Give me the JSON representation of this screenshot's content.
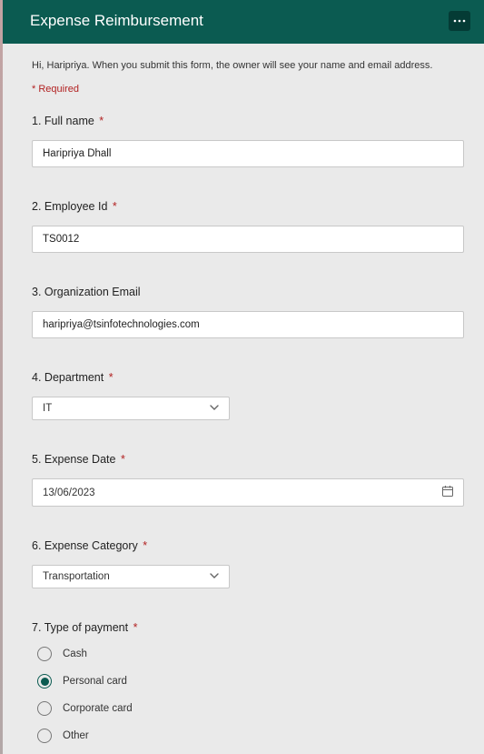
{
  "header": {
    "title": "Expense Reimbursement"
  },
  "intro": "Hi, Haripriya. When you submit this form, the owner will see your name and email address.",
  "required_note": "Required",
  "questions": {
    "q1": {
      "num": "1.",
      "label": "Full name",
      "required": true,
      "value": "Haripriya Dhall"
    },
    "q2": {
      "num": "2.",
      "label": "Employee Id",
      "required": true,
      "value": "TS0012"
    },
    "q3": {
      "num": "3.",
      "label": "Organization Email",
      "required": false,
      "value": "haripriya@tsinfotechnologies.com"
    },
    "q4": {
      "num": "4.",
      "label": "Department",
      "required": true,
      "value": "IT"
    },
    "q5": {
      "num": "5.",
      "label": "Expense Date",
      "required": true,
      "value": "13/06/2023"
    },
    "q6": {
      "num": "6.",
      "label": "Expense Category",
      "required": true,
      "value": "Transportation"
    },
    "q7": {
      "num": "7.",
      "label": "Type of payment",
      "required": true,
      "options": [
        "Cash",
        "Personal card",
        "Corporate card",
        "Other"
      ],
      "selected": "Personal card"
    }
  }
}
